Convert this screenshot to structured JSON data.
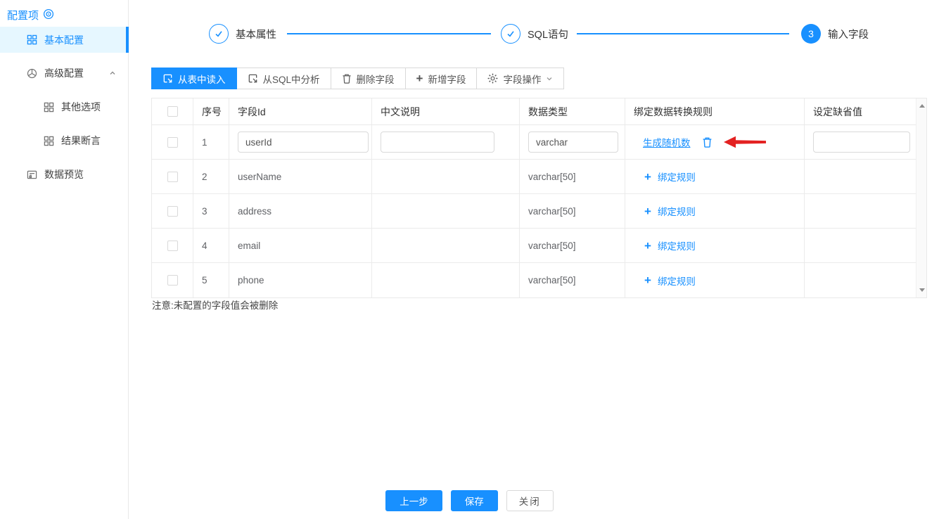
{
  "sidebar": {
    "title": "配置项",
    "items": [
      {
        "label": "基本配置"
      },
      {
        "label": "高级配置"
      },
      {
        "label": "其他选项"
      },
      {
        "label": "结果断言"
      },
      {
        "label": "数据预览"
      }
    ]
  },
  "stepper": {
    "steps": [
      {
        "label": "基本属性",
        "status": "done"
      },
      {
        "label": "SQL语句",
        "status": "done"
      },
      {
        "label": "输入字段",
        "status": "current",
        "number": "3"
      }
    ]
  },
  "toolbar": {
    "buttons": [
      {
        "label": "从表中读入"
      },
      {
        "label": "从SQL中分析"
      },
      {
        "label": "删除字段"
      },
      {
        "label": "新增字段"
      },
      {
        "label": "字段操作"
      }
    ]
  },
  "table": {
    "columns": {
      "index": "序号",
      "field_id": "字段Id",
      "description": "中文说明",
      "data_type": "数据类型",
      "rule": "绑定数据转换规则",
      "default": "设定缺省值"
    },
    "rows": [
      {
        "index": "1",
        "field_id": "userId",
        "description": "",
        "data_type": "varchar",
        "rule_label": "生成随机数",
        "default_value": ""
      },
      {
        "index": "2",
        "field_id": "userName",
        "data_type": "varchar[50]",
        "rule_label": "绑定规则"
      },
      {
        "index": "3",
        "field_id": "address",
        "data_type": "varchar[50]",
        "rule_label": "绑定规则"
      },
      {
        "index": "4",
        "field_id": "email",
        "data_type": "varchar[50]",
        "rule_label": "绑定规则"
      },
      {
        "index": "5",
        "field_id": "phone",
        "data_type": "varchar[50]",
        "rule_label": "绑定规则"
      }
    ],
    "note": "注意:未配置的字段值会被删除"
  },
  "footer": {
    "buttons": [
      {
        "label": "上一步"
      },
      {
        "label": "保存"
      },
      {
        "label": "关闭"
      }
    ]
  },
  "colors": {
    "primary": "#1890ff",
    "active_item_bg": "#e6f7ff",
    "link": "#1890ff",
    "annotation_arrow": "#e32121"
  }
}
